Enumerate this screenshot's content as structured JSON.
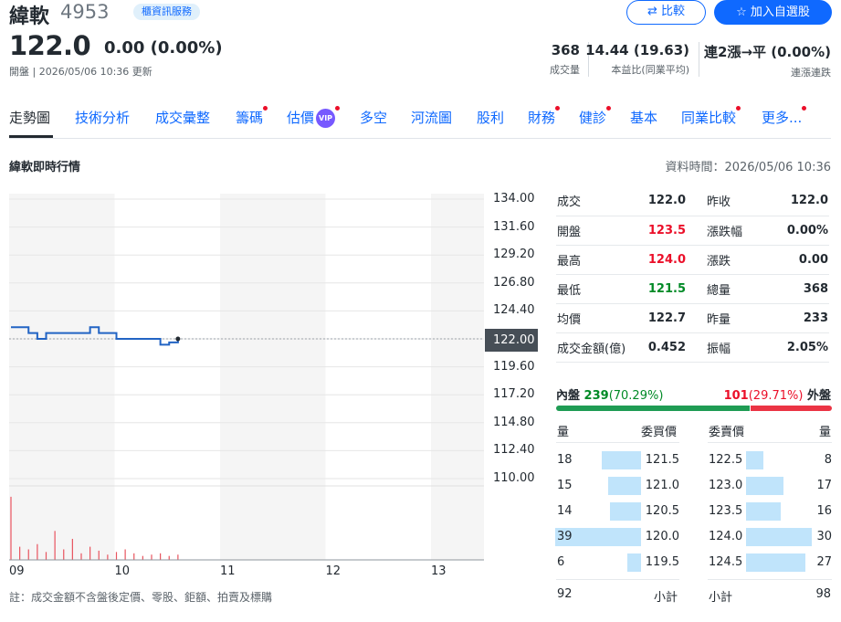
{
  "stock": {
    "name": "緯軟",
    "code": "4953",
    "tag": "櫃資訊服務",
    "price": "122.0",
    "change": "0.00 (0.00%)",
    "updated": "開盤 | 2026/05/06 10:36 更新"
  },
  "actions": {
    "compare": "比較",
    "add_watchlist": "加入自選股"
  },
  "stats": [
    {
      "value": "368",
      "label": "成交量"
    },
    {
      "value": "14.44 (19.63)",
      "label": "本益比(同業平均)"
    },
    {
      "value": "連2漲→平 (0.00%)",
      "label": "連漲連跌"
    }
  ],
  "tabs": [
    {
      "label": "走勢圖",
      "active": true,
      "dot": false
    },
    {
      "label": "技術分析",
      "active": false,
      "dot": false
    },
    {
      "label": "成交彙整",
      "active": false,
      "dot": false
    },
    {
      "label": "籌碼",
      "active": false,
      "dot": true
    },
    {
      "label": "估價",
      "active": false,
      "dot": true,
      "vip": "VIP"
    },
    {
      "label": "多空",
      "active": false,
      "dot": false
    },
    {
      "label": "河流圖",
      "active": false,
      "dot": false
    },
    {
      "label": "股利",
      "active": false,
      "dot": false
    },
    {
      "label": "財務",
      "active": false,
      "dot": true
    },
    {
      "label": "健診",
      "active": false,
      "dot": true
    },
    {
      "label": "基本",
      "active": false,
      "dot": false
    },
    {
      "label": "同業比較",
      "active": false,
      "dot": true
    },
    {
      "label": "更多...",
      "active": false,
      "dot": true
    }
  ],
  "section": {
    "title": "緯軟即時行情",
    "data_time": "資料時間：2026/05/06 10:36",
    "note": "註：成交金額不含盤後定價、零股、鉅額、拍賣及標購"
  },
  "chart_data": {
    "type": "line",
    "y_ticks": [
      "134.00",
      "131.60",
      "129.20",
      "126.80",
      "124.40",
      "122.00",
      "119.60",
      "117.20",
      "114.80",
      "112.40",
      "110.00"
    ],
    "x_ticks": [
      "09",
      "10",
      "11",
      "12",
      "13"
    ],
    "ylim": [
      110.0,
      134.0
    ],
    "current_price": "122.00",
    "reference_price": 122.0,
    "x": [
      "09:00",
      "09:05",
      "09:10",
      "09:15",
      "09:20",
      "09:25",
      "09:30",
      "09:35",
      "09:40",
      "09:45",
      "09:50",
      "09:55",
      "10:00",
      "10:05",
      "10:10",
      "10:15",
      "10:20",
      "10:25",
      "10:30",
      "10:35"
    ],
    "series": [
      {
        "values": [
          123.0,
          123.0,
          122.5,
          122.0,
          122.5,
          122.5,
          122.5,
          122.5,
          122.5,
          123.0,
          122.5,
          122.5,
          122.0,
          122.0,
          122.0,
          122.0,
          122.0,
          121.5,
          121.7,
          122.0
        ]
      }
    ],
    "volume": [
      48,
      10,
      8,
      12,
      6,
      22,
      8,
      16,
      5,
      10,
      7,
      4,
      6,
      8,
      5,
      3,
      4,
      5,
      3,
      4
    ]
  },
  "quote": [
    {
      "l1": "成交",
      "v1": "122.0",
      "c1": "",
      "l2": "昨收",
      "v2": "122.0",
      "c2": ""
    },
    {
      "l1": "開盤",
      "v1": "123.5",
      "c1": "up",
      "l2": "漲跌幅",
      "v2": "0.00%",
      "c2": ""
    },
    {
      "l1": "最高",
      "v1": "124.0",
      "c1": "up",
      "l2": "漲跌",
      "v2": "0.00",
      "c2": ""
    },
    {
      "l1": "最低",
      "v1": "121.5",
      "c1": "down",
      "l2": "總量",
      "v2": "368",
      "c2": ""
    },
    {
      "l1": "均價",
      "v1": "122.7",
      "c1": "",
      "l2": "昨量",
      "v2": "233",
      "c2": ""
    },
    {
      "l1": "成交金額(億)",
      "v1": "0.452",
      "c1": "",
      "l2": "振幅",
      "v2": "2.05%",
      "c2": ""
    }
  ],
  "inner_outer": {
    "inner_label": "內盤",
    "inner_value": "239",
    "inner_pct": "(70.29%)",
    "outer_value": "101",
    "outer_pct": "(29.71%)",
    "outer_label": "外盤",
    "inner_ratio": 0.7029
  },
  "orderbook": {
    "bid_headers": [
      "量",
      "委買價"
    ],
    "ask_headers": [
      "委賣價",
      "量"
    ],
    "bids": [
      {
        "qty": "18",
        "price": "121.5",
        "share": 0.46
      },
      {
        "qty": "15",
        "price": "121.0",
        "share": 0.38
      },
      {
        "qty": "14",
        "price": "120.5",
        "share": 0.36
      },
      {
        "qty": "39",
        "price": "120.0",
        "share": 1.0
      },
      {
        "qty": "6",
        "price": "119.5",
        "share": 0.16
      }
    ],
    "asks": [
      {
        "price": "122.5",
        "qty": "8",
        "share": 0.27
      },
      {
        "price": "123.0",
        "qty": "17",
        "share": 0.57
      },
      {
        "price": "123.5",
        "qty": "16",
        "share": 0.53
      },
      {
        "price": "124.0",
        "qty": "30",
        "share": 1.0
      },
      {
        "price": "124.5",
        "qty": "27",
        "share": 0.9
      }
    ],
    "bid_total": "92",
    "subtotal_label": "小計",
    "ask_total": "98"
  },
  "colors": {
    "accent": "#0f69ff",
    "up": "#eb0f29",
    "down": "#008a26",
    "line": "#2264c4",
    "volume": "#e8545f"
  }
}
